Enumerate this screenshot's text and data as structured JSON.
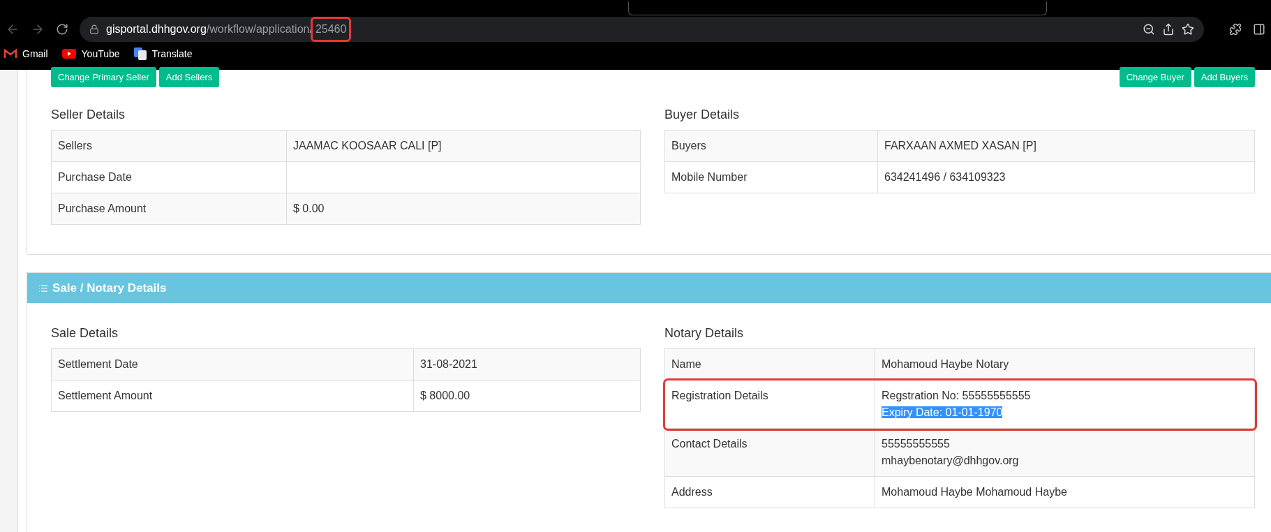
{
  "browser": {
    "url": {
      "host": "gisportal.dhhgov.org",
      "path": "/workflow/application/",
      "tail": "25460",
      "tail_annotated": true
    },
    "bookmarks": [
      {
        "label": "Gmail",
        "kind": "mail"
      },
      {
        "label": "YouTube",
        "kind": "video"
      },
      {
        "label": "Translate",
        "kind": "translate"
      }
    ]
  },
  "seller_actions": [
    "Change Primary Seller",
    "Add Sellers"
  ],
  "buyer_actions": [
    "Change Buyer",
    "Add Buyers"
  ],
  "seller_details": {
    "title": "Seller Details",
    "rows": [
      {
        "label": "Sellers",
        "values": [
          "JAAMAC KOOSAAR CALI [P]"
        ]
      },
      {
        "label": "Purchase Date",
        "values": []
      },
      {
        "label": "Purchase Amount",
        "values": [
          "$ 0.00"
        ]
      }
    ]
  },
  "buyer_details": {
    "title": "Buyer Details",
    "rows": [
      {
        "label": "Buyers",
        "values": [
          "FARXAAN AXMED XASAN [P]"
        ]
      },
      {
        "label": "Mobile Number",
        "values": [
          "634241496 / 634109323"
        ]
      }
    ]
  },
  "section": {
    "title": "Sale / Notary Details"
  },
  "sale_details": {
    "title": "Sale Details",
    "rows": [
      {
        "label": "Settlement Date",
        "values": [
          "31-08-2021"
        ]
      },
      {
        "label": "Settlement Amount",
        "values": [
          "$ 8000.00"
        ]
      }
    ]
  },
  "notary_details": {
    "title": "Notary Details",
    "rows": [
      {
        "label": "Name",
        "values": [
          "Mohamoud Haybe Notary"
        ]
      },
      {
        "label": "Registration Details",
        "annotated": true,
        "values": [
          "Regstration No: 55555555555",
          {
            "text": "Expiry Date: 01-01-1970",
            "selected": true
          }
        ]
      },
      {
        "label": "Contact Details",
        "values": [
          "55555555555",
          "mhaybenotary@dhhgov.org"
        ]
      },
      {
        "label": "Address",
        "values": [
          "Mohamoud Haybe Mohamoud Haybe"
        ]
      }
    ]
  }
}
